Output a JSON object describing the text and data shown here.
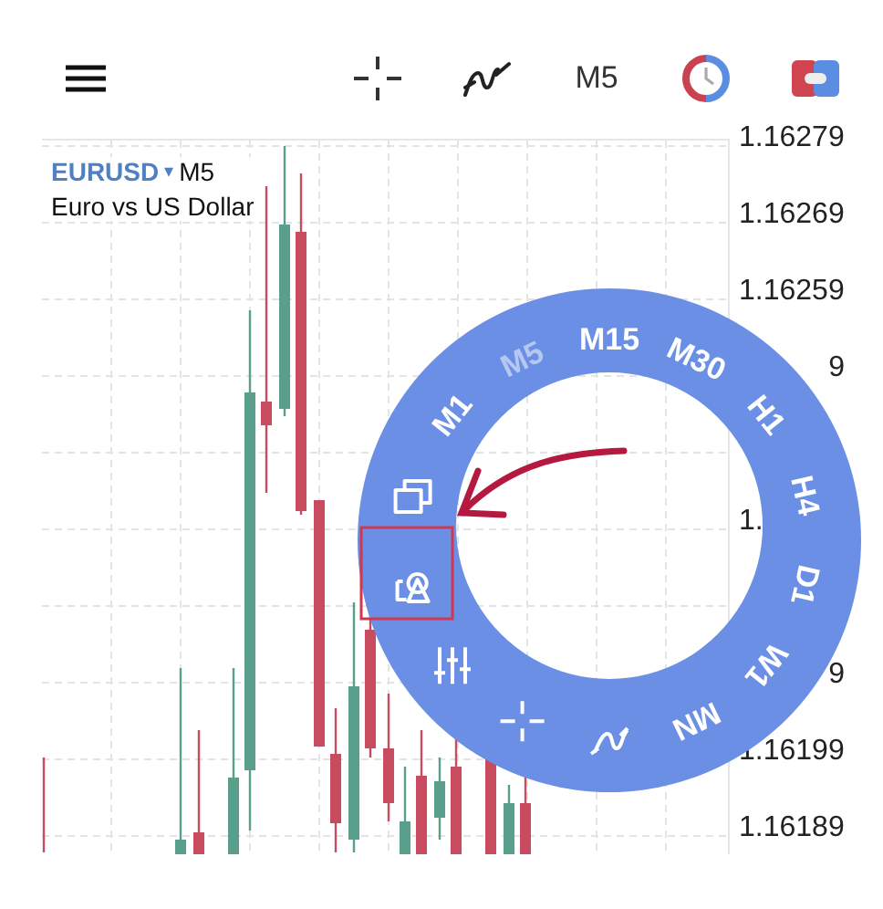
{
  "toolbar": {
    "timeframe": "M5"
  },
  "chart": {
    "symbol": "EURUSD",
    "symbol_caret": "▾",
    "timeframe": "M5",
    "description": "Euro vs US Dollar"
  },
  "price_axis": [
    {
      "kind": "full",
      "text": "1.16279"
    },
    {
      "kind": "full",
      "text": "1.16269"
    },
    {
      "kind": "full",
      "text": "1.16259"
    },
    {
      "kind": "tail",
      "text": "9"
    },
    {
      "kind": "head",
      "text": "1."
    },
    {
      "kind": "tail",
      "text": "9"
    },
    {
      "kind": "full",
      "text": "1.16199"
    },
    {
      "kind": "full",
      "text": "1.16189"
    }
  ],
  "timeframe_wheel": [
    {
      "label": "M1",
      "selected": false
    },
    {
      "label": "M5",
      "selected": true
    },
    {
      "label": "M15",
      "selected": false
    },
    {
      "label": "M30",
      "selected": false
    },
    {
      "label": "H1",
      "selected": false
    },
    {
      "label": "H4",
      "selected": false
    },
    {
      "label": "D1",
      "selected": false
    },
    {
      "label": "W1",
      "selected": false
    },
    {
      "label": "MN",
      "selected": false
    }
  ]
}
